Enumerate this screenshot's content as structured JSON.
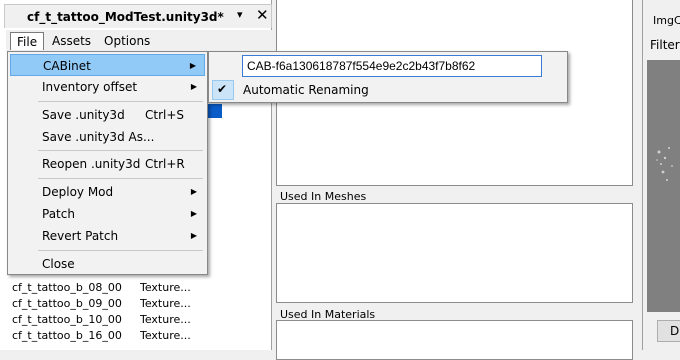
{
  "document_tab": {
    "title": "cf_t_tattoo_ModTest.unity3d*",
    "pin_icon": "▾",
    "close_icon": "✕"
  },
  "menubar": [
    "File",
    "Assets",
    "Options"
  ],
  "file_menu": [
    {
      "label": "CABinet",
      "submenu": true
    },
    {
      "label": "Inventory offset",
      "submenu": true
    },
    {
      "label": "Save .unity3d",
      "shortcut": "Ctrl+S"
    },
    {
      "label": "Save .unity3d As..."
    },
    {
      "label": "Reopen .unity3d",
      "shortcut": "Ctrl+R"
    },
    {
      "label": "Deploy Mod",
      "submenu": true
    },
    {
      "label": "Patch",
      "submenu": true
    },
    {
      "label": "Revert Patch",
      "submenu": true
    },
    {
      "label": "Close"
    }
  ],
  "cabinet_submenu": {
    "cab_name": "CAB-f6a130618787f554e9e2c2b43f7b8f62",
    "automatic_renaming": {
      "label": "Automatic Renaming",
      "checked": true
    }
  },
  "asset_list": [
    {
      "name": "cf_t_tattoo_b_08_00",
      "type": "Texture..."
    },
    {
      "name": "cf_t_tattoo_b_09_00",
      "type": "Texture..."
    },
    {
      "name": "cf_t_tattoo_b_10_00",
      "type": "Texture..."
    },
    {
      "name": "cf_t_tattoo_b_16_00",
      "type": "Texture..."
    }
  ],
  "middle_panel": {
    "used_in_meshes": "Used In Meshes",
    "used_in_materials": "Used In Materials"
  },
  "right_panel": {
    "img_count": "ImgCo",
    "filter": "Filter",
    "button": "Di"
  },
  "icons": {
    "submenu_arrow": "▶",
    "check": "✔"
  }
}
